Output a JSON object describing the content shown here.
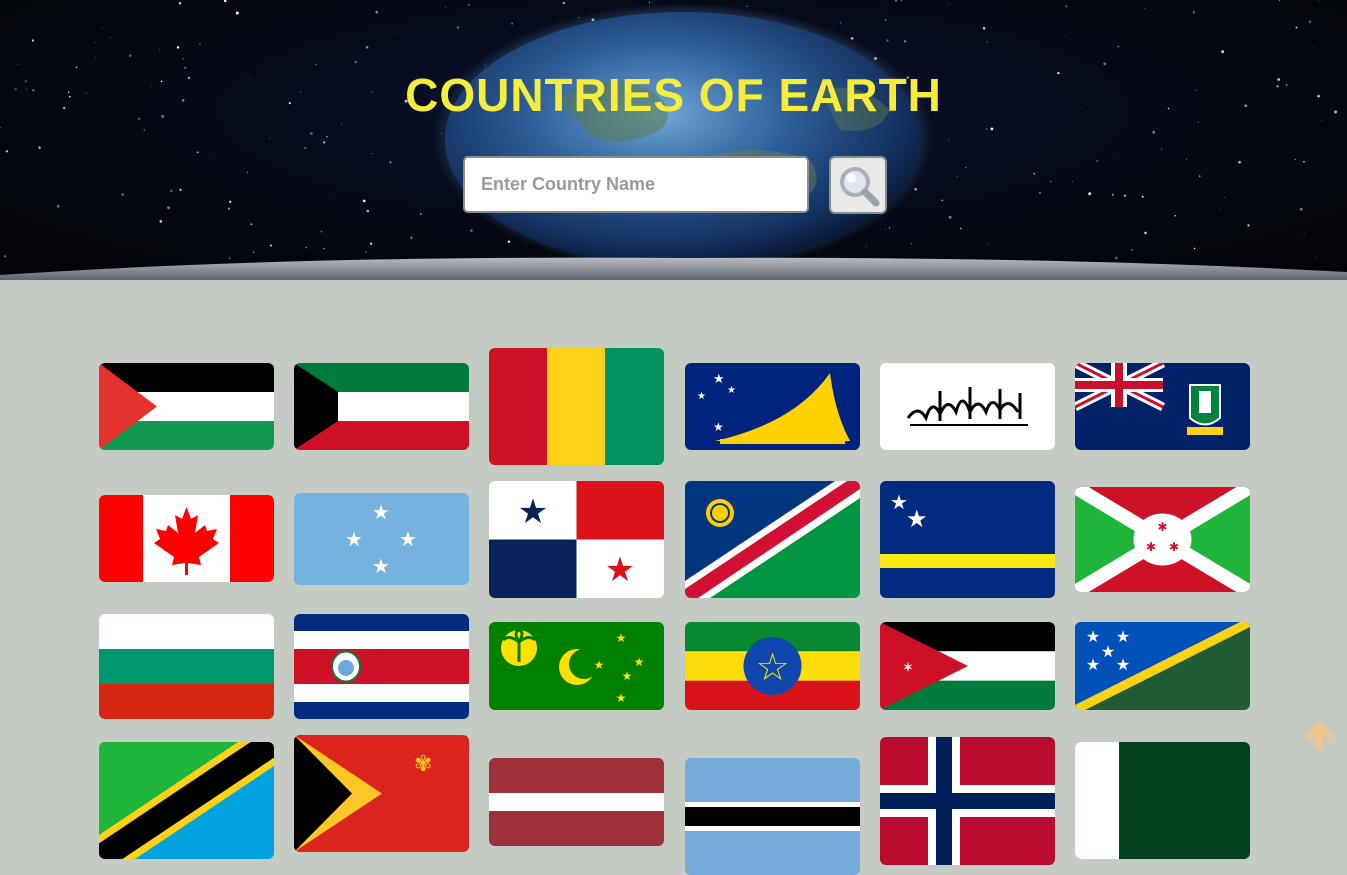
{
  "header": {
    "title": "COUNTRIES OF EARTH",
    "search": {
      "placeholder": "Enter Country Name",
      "value": "",
      "button_icon": "magnifier-icon"
    }
  },
  "colors": {
    "title": "#f5ec3c",
    "page_background": "#c3cbc3",
    "scroll_top_arrow": "#f3c78b"
  },
  "flags": [
    {
      "country": "Palestine",
      "icon": "palestine-flag-icon"
    },
    {
      "country": "Kuwait",
      "icon": "kuwait-flag-icon"
    },
    {
      "country": "Guinea",
      "icon": "guinea-flag-icon"
    },
    {
      "country": "Tokelau",
      "icon": "tokelau-flag-icon"
    },
    {
      "country": "Afghanistan",
      "icon": "afghanistan-flag-icon"
    },
    {
      "country": "British Virgin Islands",
      "icon": "british-virgin-islands-flag-icon"
    },
    {
      "country": "Canada",
      "icon": "canada-flag-icon"
    },
    {
      "country": "Micronesia",
      "icon": "micronesia-flag-icon"
    },
    {
      "country": "Panama",
      "icon": "panama-flag-icon"
    },
    {
      "country": "Namibia",
      "icon": "namibia-flag-icon"
    },
    {
      "country": "Curaçao",
      "icon": "curacao-flag-icon"
    },
    {
      "country": "Burundi",
      "icon": "burundi-flag-icon"
    },
    {
      "country": "Bulgaria",
      "icon": "bulgaria-flag-icon"
    },
    {
      "country": "Costa Rica",
      "icon": "costa-rica-flag-icon"
    },
    {
      "country": "Cocos (Keeling) Islands",
      "icon": "cocos-islands-flag-icon"
    },
    {
      "country": "Ethiopia",
      "icon": "ethiopia-flag-icon"
    },
    {
      "country": "Jordan",
      "icon": "jordan-flag-icon"
    },
    {
      "country": "Solomon Islands",
      "icon": "solomon-islands-flag-icon"
    },
    {
      "country": "Tanzania",
      "icon": "tanzania-flag-icon"
    },
    {
      "country": "Timor-Leste",
      "icon": "timor-leste-flag-icon"
    },
    {
      "country": "Latvia",
      "icon": "latvia-flag-icon"
    },
    {
      "country": "Botswana",
      "icon": "botswana-flag-icon"
    },
    {
      "country": "Norway",
      "icon": "norway-flag-icon"
    },
    {
      "country": "Pakistan",
      "icon": "pakistan-flag-icon"
    }
  ],
  "scroll_top": {
    "icon": "arrow-up-icon"
  }
}
